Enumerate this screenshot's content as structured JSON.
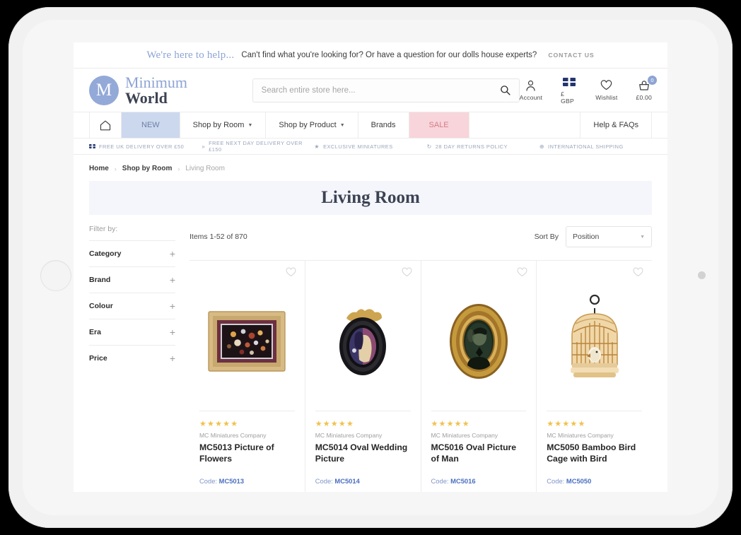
{
  "help_bar": {
    "headline": "We're here to help...",
    "message": "Can't find what you're looking for? Or have a question for our dolls house experts?",
    "cta": "CONTACT US"
  },
  "header": {
    "logo": {
      "monogram": "M",
      "line1": "Minimum",
      "line2": "World"
    },
    "search": {
      "placeholder": "Search entire store here...",
      "value": "",
      "icon": "search-icon"
    },
    "actions": [
      {
        "label": "Account",
        "icon": "user-icon"
      },
      {
        "label": "£ GBP",
        "icon": "uk-flag-icon"
      },
      {
        "label": "Wishlist",
        "icon": "heart-icon"
      },
      {
        "label": "£0.00",
        "icon": "basket-icon",
        "badge": "0"
      }
    ]
  },
  "nav": {
    "home_icon": "home-icon",
    "items": [
      {
        "label": "NEW",
        "style": "new",
        "caret": false
      },
      {
        "label": "Shop by Room",
        "style": "plain",
        "caret": true
      },
      {
        "label": "Shop by Product",
        "style": "plain",
        "caret": true
      },
      {
        "label": "Brands",
        "style": "plain",
        "caret": false
      },
      {
        "label": "SALE",
        "style": "sale",
        "caret": false
      }
    ],
    "help_label": "Help & FAQs"
  },
  "usp_bar": [
    {
      "icon": "uk-flag-icon",
      "label": "FREE UK DELIVERY OVER £50"
    },
    {
      "icon": "double-chevron-icon",
      "label": "FREE NEXT DAY DELIVERY OVER £150"
    },
    {
      "icon": "star-icon",
      "label": "EXCLUSIVE MINIATURES"
    },
    {
      "icon": "refresh-icon",
      "label": "28 DAY RETURNS POLICY"
    },
    {
      "icon": "globe-icon",
      "label": "INTERNATIONAL SHIPPING"
    }
  ],
  "breadcrumb": [
    {
      "label": "Home",
      "current": false
    },
    {
      "label": "Shop by Room",
      "current": false
    },
    {
      "label": "Living Room",
      "current": true
    }
  ],
  "page": {
    "title": "Living Room"
  },
  "sidebar": {
    "heading": "Filter by:",
    "filters": [
      {
        "label": "Category",
        "toggle": "+"
      },
      {
        "label": "Brand",
        "toggle": "+"
      },
      {
        "label": "Colour",
        "toggle": "+"
      },
      {
        "label": "Era",
        "toggle": "+"
      },
      {
        "label": "Price",
        "toggle": "+"
      }
    ]
  },
  "toolbar": {
    "items_count": "Items 1-52 of 870",
    "sort_label": "Sort By",
    "sort_value": "Position"
  },
  "products": [
    {
      "stars": "★★★★★",
      "rating": 5,
      "brand": "MC Miniatures Company",
      "name": "MC5013 Picture of Flowers",
      "code_label": "Code:",
      "code": "MC5013",
      "image": "framed-flower-painting",
      "wishlist_icon": "heart-outline-icon"
    },
    {
      "stars": "★★★★★",
      "rating": 5,
      "brand": "MC Miniatures Company",
      "name": "MC5014 Oval Wedding Picture",
      "code_label": "Code:",
      "code": "MC5014",
      "image": "oval-wedding-portrait",
      "wishlist_icon": "heart-outline-icon"
    },
    {
      "stars": "★★★★★",
      "rating": 5,
      "brand": "MC Miniatures Company",
      "name": "MC5016 Oval Picture of Man",
      "code_label": "Code:",
      "code": "MC5016",
      "image": "oval-man-portrait",
      "wishlist_icon": "heart-outline-icon"
    },
    {
      "stars": "★★★★★",
      "rating": 5,
      "brand": "MC Miniatures Company",
      "name": "MC5050 Bamboo Bird Cage with Bird",
      "code_label": "Code:",
      "code": "MC5050",
      "image": "bamboo-bird-cage",
      "wishlist_icon": "heart-outline-icon"
    }
  ],
  "colors": {
    "brand_blue": "#8da4d4",
    "nav_new_bg": "#ccd8ee",
    "nav_sale_bg": "#f8d5da",
    "banner_bg": "#f4f6fc",
    "star_gold": "#f0c14b",
    "code_link": "#4a6fc0"
  }
}
